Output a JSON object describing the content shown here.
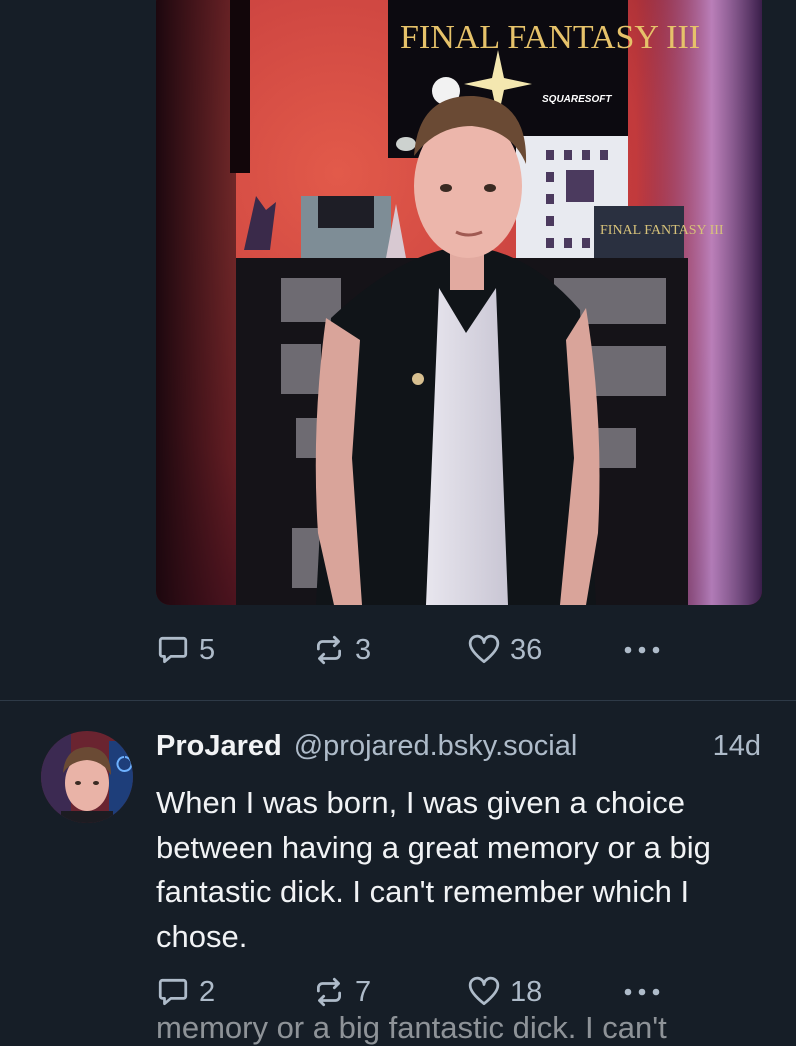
{
  "post1": {
    "photo": {
      "poster_title": "FINAL FANTASY III",
      "poster_publisher": "SQUARESOFT",
      "box_title": "FINAL FANTASY III"
    },
    "actions": {
      "replies": "5",
      "reposts": "3",
      "likes": "36"
    }
  },
  "post2": {
    "author_name": "ProJared",
    "author_handle": "@projared.bsky.social",
    "time": "14d",
    "text": "When I was born, I was given a choice between having a great memory or a big fantastic dick. I can't remember which I chose.",
    "actions": {
      "replies": "2",
      "reposts": "7",
      "likes": "18"
    },
    "next_post_peek": "memory or a big fantastic dick. I can't"
  },
  "icons": {
    "reply": "reply-bubble-icon",
    "repost": "repost-arrows-icon",
    "like": "heart-icon",
    "more": "more-dots-icon"
  },
  "colors": {
    "background": "#161e27",
    "muted_text": "#aebbc9",
    "divider": "#2e3a47"
  }
}
